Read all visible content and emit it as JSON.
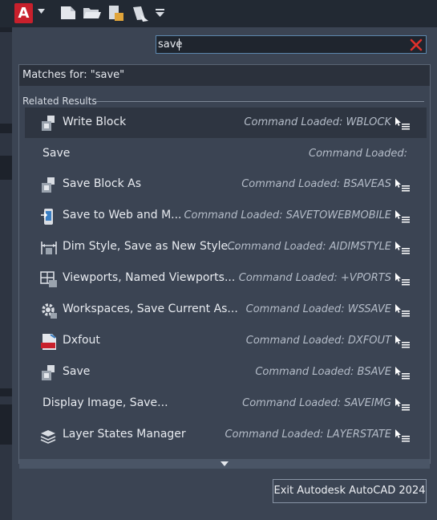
{
  "app": {
    "logo_letter": "A",
    "brand_color": "#c8202c"
  },
  "quick_access": [
    "new-file-icon",
    "open-folder-icon",
    "save-icon",
    "save-as-icon",
    "customize-dropdown-icon"
  ],
  "search": {
    "value": "save",
    "placeholder": ""
  },
  "matches_label": "Matches for: \"save\"",
  "related_label": "Related Results",
  "results": [
    {
      "icon": "write-block-icon",
      "name": "Write Block",
      "command": "Command Loaded: WBLOCK",
      "help": true,
      "selected": true
    },
    {
      "icon": "",
      "name": "Save",
      "command": "Command Loaded:",
      "help": false,
      "selected": false
    },
    {
      "icon": "save-block-as-icon",
      "name": "Save Block As",
      "command": "Command Loaded: BSAVEAS",
      "help": true,
      "selected": false
    },
    {
      "icon": "save-to-web-icon",
      "name": "Save to Web and M...",
      "command": "Command Loaded: SAVETOWEBMOBILE",
      "help": true,
      "selected": false
    },
    {
      "icon": "dim-style-icon",
      "name": "Dim Style, Save as New Style...",
      "command": "Command Loaded: AIDIMSTYLE",
      "help": true,
      "selected": false
    },
    {
      "icon": "viewports-icon",
      "name": "Viewports, Named Viewports...",
      "command": "Command Loaded: +VPORTS",
      "help": true,
      "selected": false
    },
    {
      "icon": "workspaces-gear-icon",
      "name": "Workspaces, Save Current As...",
      "command": "Command Loaded: WSSAVE",
      "help": true,
      "selected": false
    },
    {
      "icon": "dxf-file-icon",
      "name": "Dxfout",
      "command": "Command Loaded: DXFOUT",
      "help": true,
      "selected": false
    },
    {
      "icon": "block-save-icon",
      "name": "Save",
      "command": "Command Loaded: BSAVE",
      "help": true,
      "selected": false
    },
    {
      "icon": "",
      "name": "Display Image, Save...",
      "command": "Command Loaded: SAVEIMG",
      "help": true,
      "selected": false
    },
    {
      "icon": "layer-states-icon",
      "name": "Layer States Manager",
      "command": "Command Loaded: LAYERSTATE",
      "help": true,
      "selected": false
    }
  ],
  "exit_label": "Exit Autodesk AutoCAD 2024"
}
